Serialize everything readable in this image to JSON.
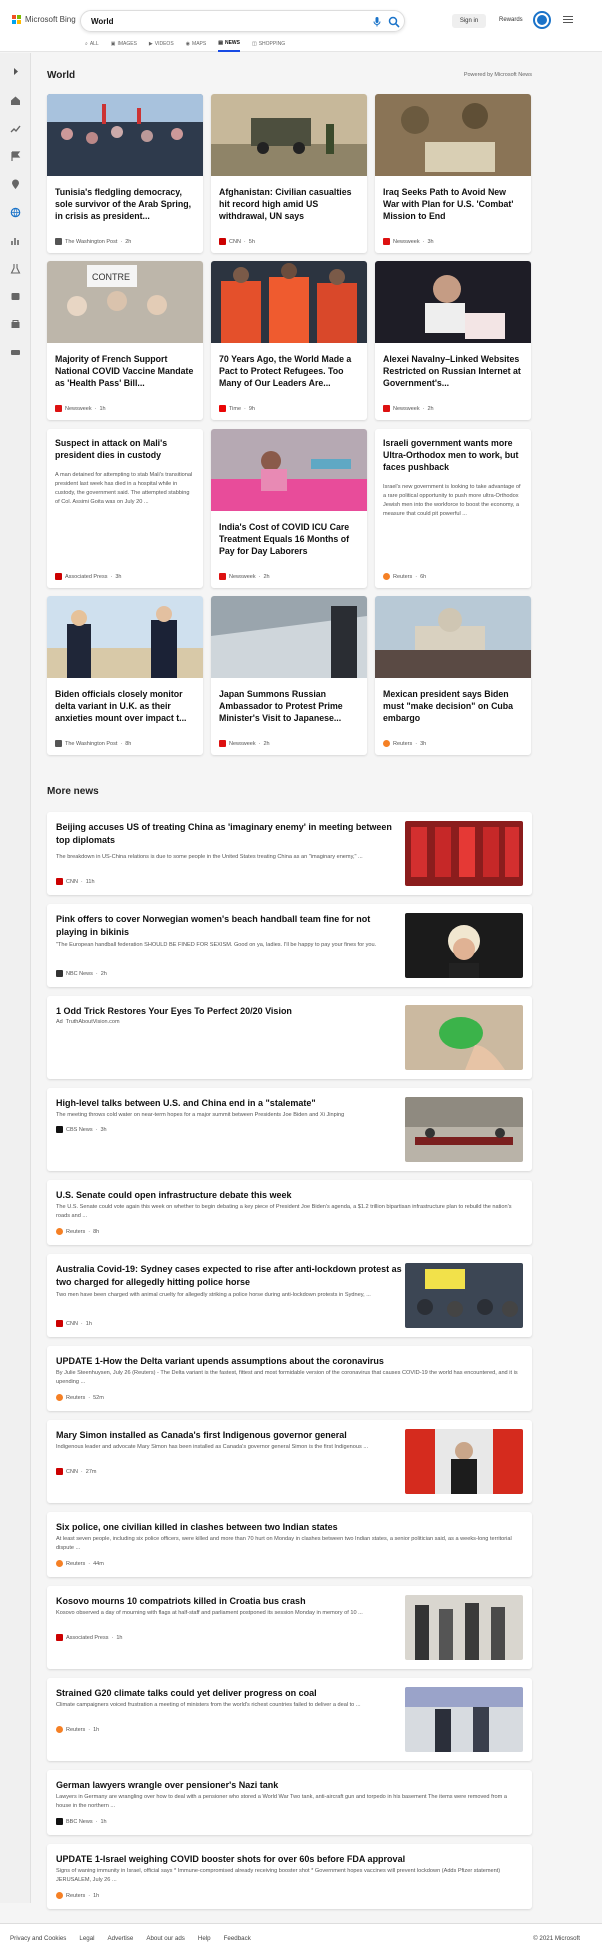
{
  "header": {
    "brand": "Microsoft Bing",
    "search_value": "World",
    "sign_in": "Sign in",
    "rewards": "Rewards",
    "tabs": [
      "ALL",
      "IMAGES",
      "VIDEOS",
      "MAPS",
      "NEWS",
      "SHOPPING"
    ],
    "active_tab": "NEWS",
    "accent": "#174ae4"
  },
  "world": {
    "title": "World",
    "powered": "Powered by Microsoft News",
    "cards": [
      {
        "title": "Tunisia's fledgling democracy, sole survivor of the Arab Spring, in crisis as president...",
        "source": "The Washington Post",
        "time": "2h"
      },
      {
        "title": "Afghanistan: Civilian casualties hit record high amid US withdrawal, UN says",
        "source": "CNN",
        "time": "5h"
      },
      {
        "title": "Iraq Seeks Path to Avoid New War with Plan for U.S. 'Combat' Mission to End",
        "source": "Newsweek",
        "time": "3h"
      },
      {
        "title": "Majority of French Support National COVID Vaccine Mandate as 'Health Pass' Bill...",
        "source": "Newsweek",
        "time": "1h"
      },
      {
        "title": "70 Years Ago, the World Made a Pact to Protect Refugees. Too Many of Our Leaders Are...",
        "source": "Time",
        "time": "9h"
      },
      {
        "title": "Alexei Navalny–Linked Websites Restricted on Russian Internet at Government's...",
        "source": "Newsweek",
        "time": "2h"
      },
      {
        "title": "Suspect in attack on Mali's president dies in custody",
        "snippet": "A man detained for attempting to stab Mali's transitional president last week has died in a hospital while in custody, the government said. The attempted stabbing of Col. Assimi Goita was on July 20 ...",
        "source": "Associated Press",
        "time": "3h"
      },
      {
        "title": "India's Cost of COVID ICU Care Treatment Equals 16 Months of Pay for Day Laborers",
        "source": "Newsweek",
        "time": "2h"
      },
      {
        "title": "Israeli government wants more Ultra-Orthodox men to work, but faces pushback",
        "snippet": "Israel's new government is looking to take advantage of a rare political opportunity to push more ultra-Orthodox Jewish men into the workforce to boost the economy, a measure that could pit powerful ...",
        "source": "Reuters",
        "time": "6h"
      },
      {
        "title": "Biden officials closely monitor delta variant in U.K. as their anxieties mount over impact t...",
        "source": "The Washington Post",
        "time": "8h"
      },
      {
        "title": "Japan Summons Russian Ambassador to Protest Prime Minister's Visit to Japanese...",
        "source": "Newsweek",
        "time": "2h"
      },
      {
        "title": "Mexican president says Biden must \"make decision\" on Cuba embargo",
        "source": "Reuters",
        "time": "3h"
      }
    ],
    "image_sign": "CONTRE"
  },
  "more_news": {
    "title": "More news",
    "items": [
      {
        "title": "Beijing accuses US of treating China as 'imaginary enemy' in meeting between top diplomats",
        "snippet": "The breakdown in US-China relations is due to some people in the United States treating China as an \"imaginary enemy,\" ...",
        "source": "CNN",
        "time": "11h"
      },
      {
        "title": "Pink offers to cover Norwegian women's beach handball team fine for not playing in bikinis",
        "snippet": "\"The European handball federation SHOULD BE FINED FOR SEXISM. Good on ya, ladies. I'll be happy to pay your fines for you.",
        "source": "NBC News",
        "time": "2h"
      },
      {
        "title": "1 Odd Trick Restores Your Eyes To Perfect 20/20 Vision",
        "ad": "Ad",
        "source": "TruthAboutVision.com"
      },
      {
        "title": "High-level talks between U.S. and China end in a \"stalemate\"",
        "snippet": "The meeting throws cold water on near-term hopes for a major summit between Presidents Joe Biden and Xi Jinping",
        "source": "CBS News",
        "time": "3h"
      },
      {
        "title": "U.S. Senate could open infrastructure debate this week",
        "snippet": "The U.S. Senate could vote again this week on whether to begin debating a key piece of President Joe Biden's agenda, a $1.2 trillion bipartisan infrastructure plan to rebuild the nation's roads and ...",
        "source": "Reuters",
        "time": "8h"
      },
      {
        "title": "Australia Covid-19: Sydney cases expected to rise after anti-lockdown protest as two charged for allegedly hitting police horse",
        "snippet": "Two men have been charged with animal cruelty for allegedly striking a police horse during anti-lockdown protests in Sydney, ...",
        "source": "CNN",
        "time": "1h"
      },
      {
        "title": "UPDATE 1-How the Delta variant upends assumptions about the coronavirus",
        "snippet": "By Julie Steenhuysen, July 26 (Reuters) - The Delta variant is the fastest, fittest and most formidable version of the coronavirus that causes COVID-19 the world has encountered, and it is upending ...",
        "source": "Reuters",
        "time": "52m"
      },
      {
        "title": "Mary Simon installed as Canada's first Indigenous governor general",
        "snippet": "Indigenous leader and advocate Mary Simon has been installed as Canada's governor general Simon is the first Indigenous ...",
        "source": "CNN",
        "time": "27m"
      },
      {
        "title": "Six police, one civilian killed in clashes between two Indian states",
        "snippet": "At least seven people, including six police officers, were killed and more than 70 hurt on Monday in clashes between two Indian states, a senior politician said, as a weeks-long territorial dispute ...",
        "source": "Reuters",
        "time": "44m"
      },
      {
        "title": "Kosovo mourns 10 compatriots killed in Croatia bus crash",
        "snippet": "Kosovo observed a day of mourning with flags at half-staff and parliament postponed its session Monday in memory of 10 ...",
        "source": "Associated Press",
        "time": "1h"
      },
      {
        "title": "Strained G20 climate talks could yet deliver progress on coal",
        "snippet": "Climate campaigners voiced frustration a meeting of ministers from the world's richest countries failed to deliver a deal to ...",
        "source": "Reuters",
        "time": "1h"
      },
      {
        "title": "German lawyers wrangle over pensioner's Nazi tank",
        "snippet": "Lawyers in Germany are wrangling over how to deal with a pensioner who stored a World War Two tank, anti-aircraft gun and torpedo in his basement The items were removed from a house in the northern ...",
        "source": "BBC News",
        "time": "1h"
      },
      {
        "title": "UPDATE 1-Israel weighing COVID booster shots for over 60s before FDA approval",
        "snippet": "Signs of waning immunity in Israel, official says * Immune-compromised already receiving booster shot * Government hopes vaccines will prevent lockdown (Adds Pfizer statement) JERUSALEM, July 26 ...",
        "source": "Reuters",
        "time": "1h"
      }
    ]
  },
  "footer": {
    "links": [
      "Privacy and Cookies",
      "Legal",
      "Advertise",
      "About our ads",
      "Help",
      "Feedback"
    ],
    "copyright": "© 2021 Microsoft"
  }
}
